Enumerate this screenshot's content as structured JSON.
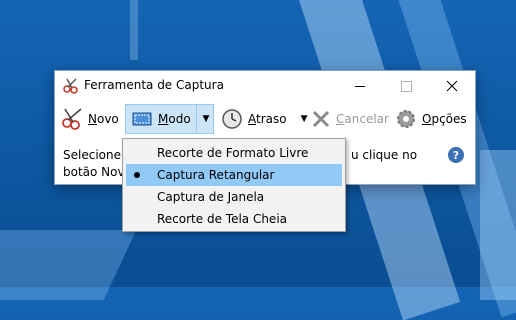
{
  "window": {
    "title": "Ferramenta de Captura"
  },
  "toolbar": {
    "new_label_underlined": "N",
    "new_label_rest": "ovo",
    "mode_label_underlined": "M",
    "mode_label_rest": "odo",
    "delay_label_underlined": "A",
    "delay_label_rest": "traso",
    "cancel_label_underlined": "C",
    "cancel_label_rest": "ancelar",
    "options_label_underlined": "O",
    "options_label_rest": "pções"
  },
  "info": {
    "line1_start": "Selecione o",
    "line1_end": "u clique no",
    "line2": "botão Novo"
  },
  "mode_menu": {
    "items": [
      {
        "label": "Recorte de Formato Livre",
        "selected": false
      },
      {
        "label": "Captura Retangular",
        "selected": true
      },
      {
        "label": "Captura de Janela",
        "selected": false
      },
      {
        "label": "Recorte de Tela Cheia",
        "selected": false
      }
    ]
  },
  "colors": {
    "desktop": "#1565b4",
    "mode_button_bg": "#cce4f7",
    "menu_selected": "#91c9f7",
    "help_icon": "#3b6fb6"
  }
}
